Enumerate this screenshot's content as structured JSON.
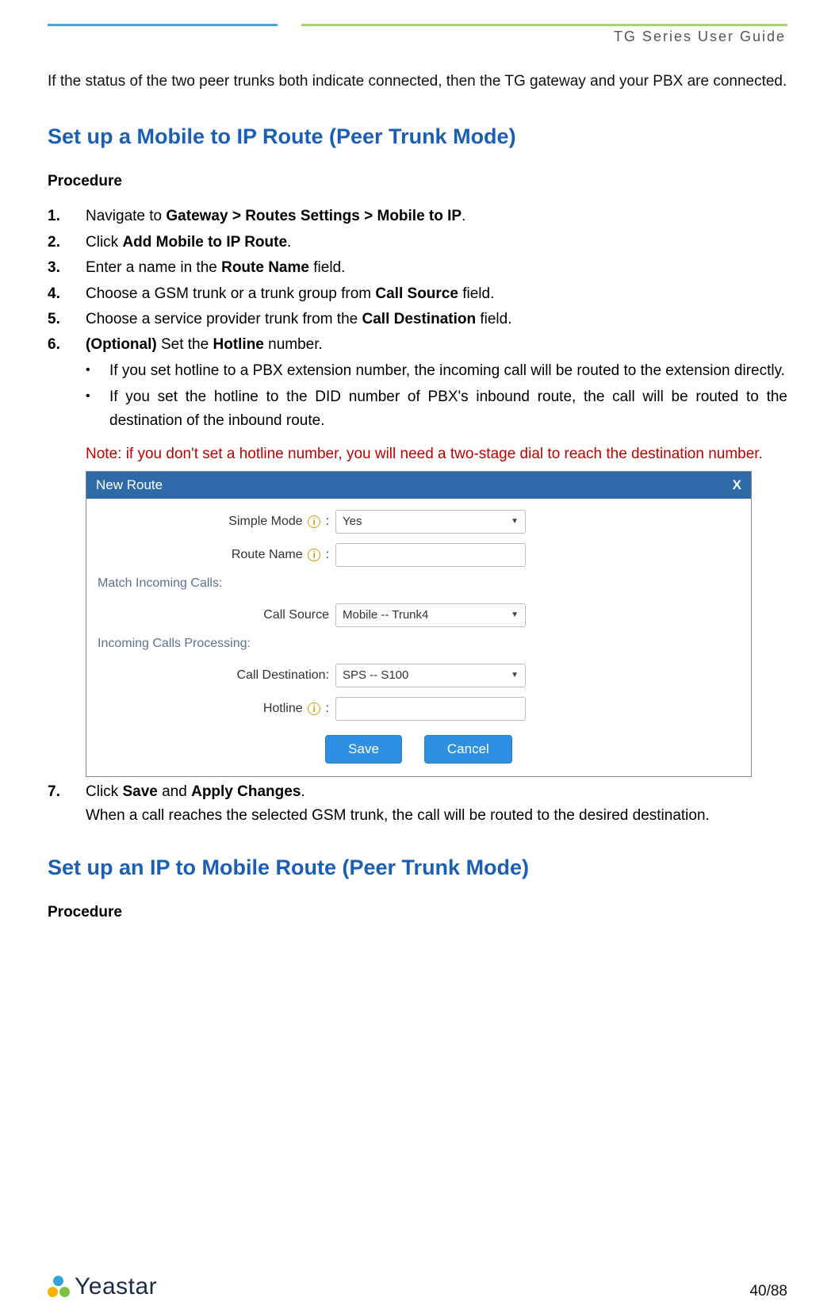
{
  "header": {
    "doc_title": "TG  Series  User  Guide"
  },
  "intro_para": "If the status of the two peer trunks both indicate connected, then the TG gateway and your PBX are connected.",
  "section1": {
    "title": "Set up a Mobile to IP Route (Peer Trunk Mode)",
    "subtitle": "Procedure",
    "steps": {
      "s1_pre": "Navigate to ",
      "s1_bold": "Gateway > Routes Settings > Mobile to IP",
      "s1_post": ".",
      "s2_pre": "Click ",
      "s2_bold": "Add Mobile to IP Route",
      "s2_post": ".",
      "s3_pre": "Enter a name in the ",
      "s3_bold": "Route Name",
      "s3_post": " field.",
      "s4_pre": "Choose a GSM trunk or a trunk group from ",
      "s4_bold": "Call Source",
      "s4_post": " field.",
      "s5_pre": "Choose a service provider trunk from the ",
      "s5_bold": "Call Destination",
      "s5_post": " field.",
      "s6_bold1": "(Optional)",
      "s6_mid": " Set the ",
      "s6_bold2": "Hotline",
      "s6_post": " number."
    },
    "bullets": {
      "b1": "If you set hotline to a PBX extension number, the incoming call will be routed to the extension directly.",
      "b2": "If you set the hotline to the DID number of PBX's inbound route, the call will be routed to the destination of the inbound route."
    },
    "note": "Note: if you don't set a hotline number, you will need a two-stage dial to reach the destination number.",
    "step7": {
      "pre": "Click ",
      "b1": "Save",
      "mid": " and ",
      "b2": "Apply Changes",
      "post": ".",
      "line2": "When a call reaches the selected GSM trunk, the call will be routed to the desired destination."
    }
  },
  "dialog": {
    "title": "New Route",
    "close": "X",
    "simple_mode_label": "Simple Mode",
    "simple_mode_value": "Yes",
    "route_name_label": "Route Name",
    "match_section": "Match Incoming Calls:",
    "call_source_label": "Call Source",
    "call_source_value": "Mobile -- Trunk4",
    "processing_section": "Incoming Calls Processing:",
    "call_dest_label": "Call Destination:",
    "call_dest_value": "SPS -- S100",
    "hotline_label": "Hotline",
    "save": "Save",
    "cancel": "Cancel",
    "info_glyph": "i",
    "colon": " :"
  },
  "section2": {
    "title": "Set up an IP to Mobile Route (Peer Trunk Mode)",
    "subtitle": "Procedure"
  },
  "footer": {
    "brand": "Yeastar",
    "page": "40/88"
  }
}
